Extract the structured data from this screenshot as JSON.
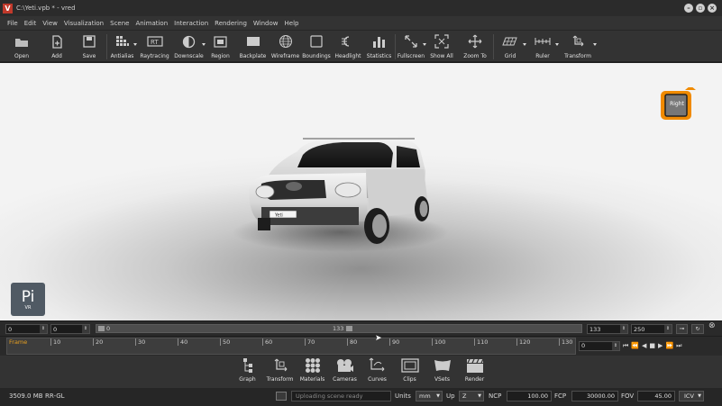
{
  "window": {
    "title": "C:\\Yeti.vpb * - vred",
    "app_icon": "V",
    "controls": [
      "minimize-icon",
      "maximize-icon",
      "close-icon"
    ]
  },
  "menu": [
    "File",
    "Edit",
    "View",
    "Visualization",
    "Scene",
    "Animation",
    "Interaction",
    "Rendering",
    "Window",
    "Help"
  ],
  "toolbar": [
    {
      "label": "Open",
      "icon": "folder-open-icon"
    },
    {
      "label": "Add",
      "icon": "add-file-icon"
    },
    {
      "label": "Save",
      "icon": "save-icon"
    },
    {
      "label": "Antialias",
      "icon": "antialias-icon"
    },
    {
      "label": "Raytracing",
      "icon": "raytracing-icon"
    },
    {
      "label": "Downscale",
      "icon": "downscale-icon"
    },
    {
      "label": "Region",
      "icon": "region-icon"
    },
    {
      "label": "Backplate",
      "icon": "backplate-icon"
    },
    {
      "label": "Wireframe",
      "icon": "wireframe-icon"
    },
    {
      "label": "Boundings",
      "icon": "boundings-icon"
    },
    {
      "label": "Headlight",
      "icon": "headlight-icon"
    },
    {
      "label": "Statistics",
      "icon": "statistics-icon"
    },
    {
      "label": "Fullscreen",
      "icon": "fullscreen-icon"
    },
    {
      "label": "Show All",
      "icon": "show-all-icon"
    },
    {
      "label": "Zoom To",
      "icon": "zoom-to-icon"
    },
    {
      "label": "Grid",
      "icon": "grid-icon"
    },
    {
      "label": "Ruler",
      "icon": "ruler-icon"
    },
    {
      "label": "Transform",
      "icon": "transform-icon"
    }
  ],
  "viewport": {
    "viewcube_label": "Right",
    "pi_logo_text": "Pi",
    "pi_logo_sub": "VR",
    "plate_text": "Yeti"
  },
  "timeline": {
    "start_value": "0",
    "second_value": "0",
    "range_start_marker": "0",
    "current_marker": "133",
    "current_frame": "133",
    "end_frame": "250",
    "ruler_label": "Frame",
    "ticks": [
      "10",
      "20",
      "30",
      "40",
      "50",
      "60",
      "70",
      "80",
      "90",
      "100",
      "110",
      "120",
      "130"
    ],
    "play_field": "0"
  },
  "dock": [
    {
      "label": "Graph",
      "icon": "graph-icon"
    },
    {
      "label": "Transform",
      "icon": "transform-icon"
    },
    {
      "label": "Materials",
      "icon": "materials-icon"
    },
    {
      "label": "Cameras",
      "icon": "cameras-icon"
    },
    {
      "label": "Curves",
      "icon": "curves-icon"
    },
    {
      "label": "Clips",
      "icon": "clips-icon"
    },
    {
      "label": "VSets",
      "icon": "vsets-icon"
    },
    {
      "label": "Render",
      "icon": "render-icon"
    }
  ],
  "status": {
    "memory": "3509.0 MB",
    "renderer": "RR-GL",
    "message": "Uploading scene ready",
    "units_label": "Units",
    "units_value": "mm",
    "up_label": "Up",
    "up_value": "Z",
    "ncp_label": "NCP",
    "ncp_value": "100.00",
    "fcp_label": "FCP",
    "fcp_value": "30000.00",
    "fov_label": "FOV",
    "fov_value": "45.00",
    "icv_label": "ICV"
  }
}
